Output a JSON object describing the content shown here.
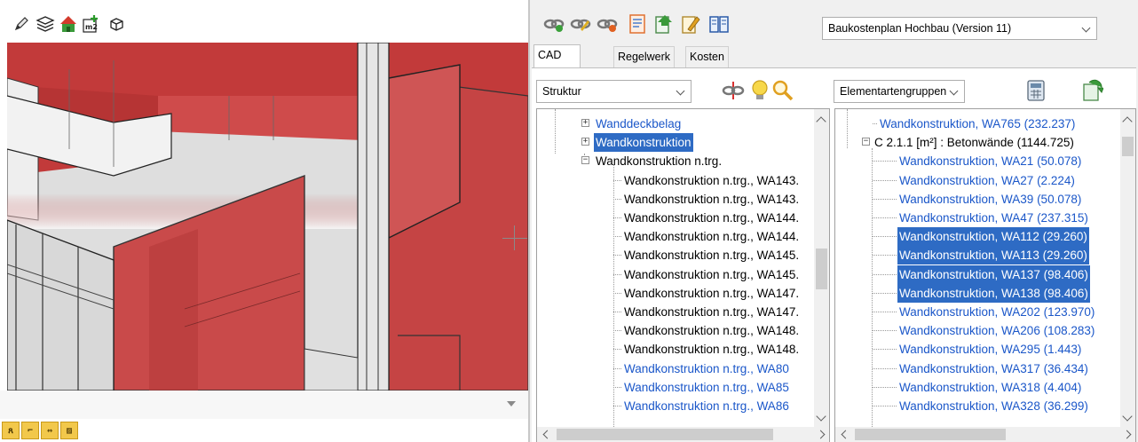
{
  "cad_toolbar": {
    "icons": [
      "pencil-icon",
      "layers-icon",
      "house-icon",
      "area-m2-icon",
      "cube-icon"
    ],
    "area_icon_text": "m2"
  },
  "view_toolbar": {
    "icons": [
      "walk-view-icon",
      "walk-side-icon",
      "measure-icon",
      "hatch-icon"
    ]
  },
  "panel_toolbar": {
    "icons": [
      "link-green-icon",
      "link-yellow-icon",
      "link-red-icon",
      "document-icon",
      "export-icon",
      "edit-icon",
      "book-icon"
    ],
    "kostenplan": {
      "value": "Baukostenplan Hochbau (Version 11)"
    }
  },
  "tabs": [
    {
      "label": "CAD Objekte",
      "active": true
    },
    {
      "label": "Regelwerk",
      "active": false
    },
    {
      "label": "Kosten",
      "active": false
    }
  ],
  "left": {
    "combo": {
      "value": "Struktur"
    },
    "tools": [
      "link-break-icon",
      "lightbulb-icon",
      "magnifier-icon"
    ],
    "tree": [
      {
        "label": "Wanddeckbelag",
        "expander": "+",
        "style": "link"
      },
      {
        "label": "Wandkonstruktion",
        "expander": "+",
        "style": "sel"
      },
      {
        "label": "Wandkonstruktion n.trg.",
        "expander": "-",
        "style": "plain"
      },
      {
        "label": "Wandkonstruktion n.trg., WA143.",
        "style": "plain"
      },
      {
        "label": "Wandkonstruktion n.trg., WA143.",
        "style": "plain"
      },
      {
        "label": "Wandkonstruktion n.trg., WA144.",
        "style": "plain"
      },
      {
        "label": "Wandkonstruktion n.trg., WA144.",
        "style": "plain"
      },
      {
        "label": "Wandkonstruktion n.trg., WA145.",
        "style": "plain"
      },
      {
        "label": "Wandkonstruktion n.trg., WA145.",
        "style": "plain"
      },
      {
        "label": "Wandkonstruktion n.trg., WA147.",
        "style": "plain"
      },
      {
        "label": "Wandkonstruktion n.trg., WA147.",
        "style": "plain"
      },
      {
        "label": "Wandkonstruktion n.trg., WA148.",
        "style": "plain"
      },
      {
        "label": "Wandkonstruktion n.trg., WA148.",
        "style": "plain"
      },
      {
        "label": "Wandkonstruktion n.trg., WA80",
        "style": "link"
      },
      {
        "label": "Wandkonstruktion n.trg., WA85",
        "style": "link"
      },
      {
        "label": "Wandkonstruktion n.trg., WA86",
        "style": "link"
      }
    ]
  },
  "right": {
    "combo": {
      "value": "Elementartengruppen"
    },
    "tools": [
      "calculator-icon",
      "refresh-sheet-icon"
    ],
    "tree": [
      {
        "label": "Wandkonstruktion, WA765  (232.237)",
        "style": "link"
      },
      {
        "label": "C 2.1.1 [m²] : Betonwände (1144.725)",
        "expander": "-",
        "style": "plain"
      },
      {
        "label": "Wandkonstruktion, WA21  (50.078)",
        "style": "link"
      },
      {
        "label": "Wandkonstruktion, WA27  (2.224)",
        "style": "link"
      },
      {
        "label": "Wandkonstruktion, WA39  (50.078)",
        "style": "link"
      },
      {
        "label": "Wandkonstruktion, WA47  (237.315)",
        "style": "link"
      },
      {
        "label": "Wandkonstruktion, WA112  (29.260)",
        "style": "sel"
      },
      {
        "label": "Wandkonstruktion, WA113  (29.260)",
        "style": "sel"
      },
      {
        "label": "Wandkonstruktion, WA137  (98.406)",
        "style": "sel"
      },
      {
        "label": "Wandkonstruktion, WA138  (98.406)",
        "style": "sel"
      },
      {
        "label": "Wandkonstruktion, WA202  (123.970)",
        "style": "link"
      },
      {
        "label": "Wandkonstruktion, WA206  (108.283)",
        "style": "link"
      },
      {
        "label": "Wandkonstruktion, WA295  (1.443)",
        "style": "link"
      },
      {
        "label": "Wandkonstruktion, WA317  (36.434)",
        "style": "link"
      },
      {
        "label": "Wandkonstruktion, WA318  (4.404)",
        "style": "link"
      },
      {
        "label": "Wandkonstruktion, WA328  (36.299)",
        "style": "link"
      }
    ]
  },
  "colors": {
    "wall_red": "#c94a4a",
    "selection": "#2e6bc4",
    "link": "#1b57c9"
  }
}
